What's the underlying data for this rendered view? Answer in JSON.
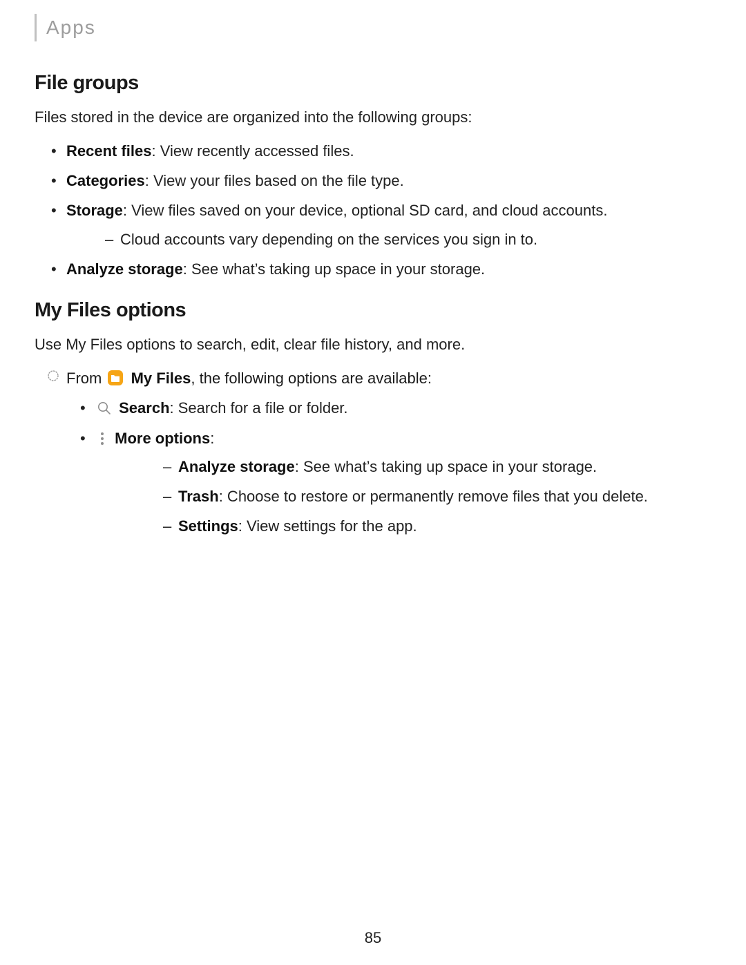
{
  "header": {
    "breadcrumb": "Apps"
  },
  "page_number": "85",
  "section1": {
    "title": "File groups",
    "intro": "Files stored in the device are organized into the following groups:",
    "items": [
      {
        "label": "Recent files",
        "text": ": View recently accessed files."
      },
      {
        "label": "Categories",
        "text": ": View your files based on the file type."
      },
      {
        "label": "Storage",
        "text": ": View files saved on your device, optional SD card, and cloud accounts."
      },
      {
        "label": "Analyze storage",
        "text": ": See what’s taking up space in your storage."
      }
    ],
    "storage_sub": "Cloud accounts vary depending on the services you sign in to."
  },
  "section2": {
    "title": "My Files options",
    "intro": "Use My Files options to search, edit, clear file history, and more.",
    "lead_prefix": "From ",
    "lead_app": "My Files",
    "lead_suffix": ", the following options are available:",
    "search": {
      "label": "Search",
      "text": ": Search for a file or folder."
    },
    "more": {
      "label": "More options",
      "text": ":"
    },
    "more_sub": [
      {
        "label": "Analyze storage",
        "text": ": See what’s taking up space in your storage."
      },
      {
        "label": "Trash",
        "text": ": Choose to restore or permanently remove files that you delete."
      },
      {
        "label": "Settings",
        "text": ": View settings for the app."
      }
    ]
  }
}
